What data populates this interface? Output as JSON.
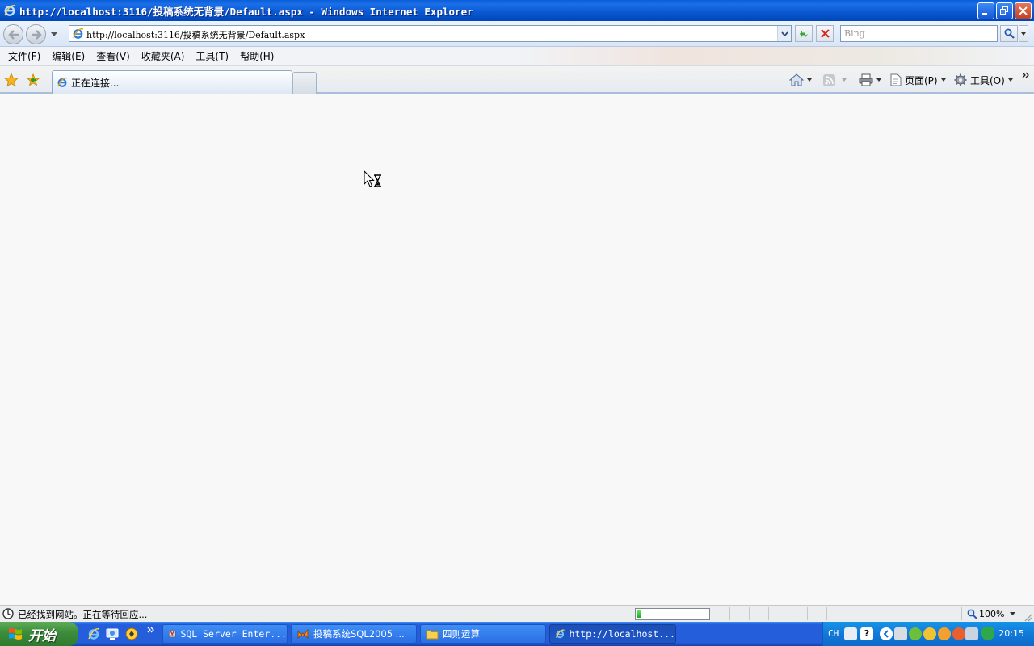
{
  "window": {
    "title": "http://localhost:3116/投稿系统无背景/Default.aspx - Windows Internet Explorer"
  },
  "address_bar": {
    "url": "http://localhost:3116/投稿系统无背景/Default.aspx"
  },
  "search": {
    "placeholder": "Bing"
  },
  "menu": {
    "items": [
      "文件(F)",
      "编辑(E)",
      "查看(V)",
      "收藏夹(A)",
      "工具(T)",
      "帮助(H)"
    ]
  },
  "tabs": {
    "active_label": "正在连接..."
  },
  "command_bar": {
    "page_label": "页面(P)",
    "tools_label": "工具(O)"
  },
  "status_bar": {
    "text": "已经找到网站。正在等待回应...",
    "progress": 0.06,
    "zoom": "100%"
  },
  "taskbar": {
    "start_label": "开始",
    "tasks": [
      {
        "label": "SQL Server Enter...",
        "icon": "sql-server-icon"
      },
      {
        "label": "投稿系统SQL2005 ...",
        "icon": "visual-studio-icon"
      },
      {
        "label": "四则运算",
        "icon": "folder-icon"
      },
      {
        "label": "http://localhost...",
        "icon": "ie-icon"
      }
    ],
    "language": "CH",
    "clock": "20:15"
  }
}
